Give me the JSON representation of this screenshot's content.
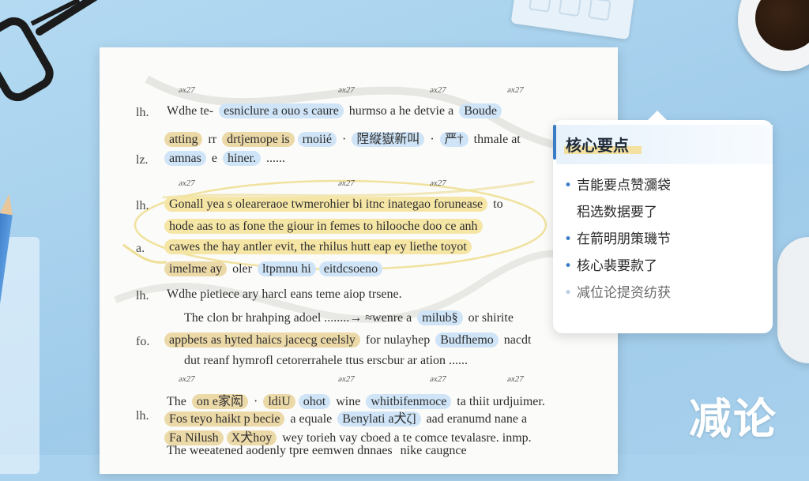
{
  "document": {
    "marks": [
      "əx27",
      "əx27",
      "əx27",
      "əx27",
      "əx27",
      "əx27",
      "əx27",
      "əx27",
      "əx27",
      "əx27",
      "əx27"
    ],
    "rows": [
      {
        "label": "lh.",
        "segments": [
          {
            "text": "Wdhe te-",
            "style": "plain"
          },
          {
            "text": "esniclure a ouo s caure",
            "style": "blue"
          },
          {
            "text": "hurmso a he detvie a",
            "style": "plain"
          },
          {
            "text": "Boude",
            "style": "blue"
          }
        ]
      },
      {
        "label": "",
        "segments": [
          {
            "text": "atting",
            "style": "tan"
          },
          {
            "text": "rr",
            "style": "plain"
          },
          {
            "text": "drtjemope is",
            "style": "tan"
          },
          {
            "text": "rnoiié",
            "style": "blue"
          },
          {
            "text": "·",
            "style": "plain"
          },
          {
            "text": "陧縦嶽新叫",
            "style": "blue"
          },
          {
            "text": "·",
            "style": "plain"
          },
          {
            "text": "严†",
            "style": "blue"
          },
          {
            "text": "thmale at",
            "style": "plain"
          }
        ]
      },
      {
        "label": "lz.",
        "segments": [
          {
            "text": "amnas",
            "style": "blue"
          },
          {
            "text": "e",
            "style": "plain"
          },
          {
            "text": "hiner.",
            "style": "blue"
          },
          {
            "text": "......",
            "style": "plain"
          }
        ]
      },
      {
        "label": "lh.",
        "segments": [
          {
            "text": "Gonall yea s oleareraoe twmerohier bi itnc inategao forunease",
            "style": "yellow"
          },
          {
            "text": "to",
            "style": "plain"
          }
        ]
      },
      {
        "label": "",
        "segments": [
          {
            "text": "hode aas to as fone the giour in femes to hilooche doo ce anh",
            "style": "yellow"
          }
        ]
      },
      {
        "label": "a.",
        "segments": [
          {
            "text": "cawes the hay antler evit, the rhilus hutt eap ey liethe toyot",
            "style": "yellow"
          }
        ]
      },
      {
        "label": "",
        "segments": [
          {
            "text": "imelme ay",
            "style": "tan"
          },
          {
            "text": "oler",
            "style": "plain"
          },
          {
            "text": "ltpmnu hi",
            "style": "blue"
          },
          {
            "text": "eitdcsoeno",
            "style": "blue"
          }
        ]
      },
      {
        "label": "lh.",
        "segments": [
          {
            "text": "Wdhe pietiece ary harcl eans teme aiop trsene.",
            "style": "plain"
          }
        ]
      },
      {
        "label": "",
        "segments": [
          {
            "text": "The clon br hrahping adoel ........→ ≈wenre a",
            "style": "plain"
          },
          {
            "text": "milub§",
            "style": "blue"
          },
          {
            "text": "or shirite",
            "style": "plain"
          }
        ]
      },
      {
        "label": "fo.",
        "segments": [
          {
            "text": "appbets as hyted haics jacecg ceelsly",
            "style": "tan"
          },
          {
            "text": "for nulayhep",
            "style": "plain"
          },
          {
            "text": "Budfhemo",
            "style": "blue"
          },
          {
            "text": "nacdt",
            "style": "plain"
          }
        ]
      },
      {
        "label": "",
        "segments": [
          {
            "text": "dut reanf hymrofl cetorerrahele ttus erscbur ar ation ......",
            "style": "plain"
          }
        ]
      },
      {
        "label": "",
        "segments": [
          {
            "text": "The",
            "style": "plain"
          },
          {
            "text": "on e家闳",
            "style": "tan"
          },
          {
            "text": "·",
            "style": "plain"
          },
          {
            "text": "ldiU",
            "style": "tan"
          },
          {
            "text": "ohot",
            "style": "blue"
          },
          {
            "text": "wine",
            "style": "plain"
          },
          {
            "text": "whitbifenmoce",
            "style": "blue"
          },
          {
            "text": "ta thiit urdjuimer.",
            "style": "plain"
          }
        ]
      },
      {
        "label": "lh.",
        "segments": [
          {
            "text": "Fos teyo haikt p becie",
            "style": "tan"
          },
          {
            "text": "a equale",
            "style": "plain"
          },
          {
            "text": "Benylati a犬ζ𣊞]",
            "style": "blue"
          },
          {
            "text": "aad eranumd nane a",
            "style": "plain"
          }
        ]
      },
      {
        "label": "",
        "segments": [
          {
            "text": "Fa Nilush",
            "style": "tan"
          },
          {
            "text": "X犬hoy",
            "style": "tan"
          },
          {
            "text": "wey torieh vay cboed a te comce tevalasre. inmp.",
            "style": "plain"
          }
        ]
      },
      {
        "label": "",
        "segments": [
          {
            "text": "The weeatened aodenly tpre eemwen dnnaes",
            "style": "plain"
          },
          {
            "text": "nike caugnce",
            "style": "plain"
          }
        ]
      }
    ]
  },
  "note": {
    "title": "核心要点",
    "items": [
      {
        "text": "吉能要点赞瀰袋",
        "bullet": true,
        "faded": false
      },
      {
        "text": "稆选数据要了",
        "bullet": false,
        "faded": false
      },
      {
        "text": "在箭明朋策璣节",
        "bullet": true,
        "faded": false
      },
      {
        "text": "核心裴要款了",
        "bullet": true,
        "faded": false
      },
      {
        "text": "减位论提资纺获",
        "bullet": true,
        "faded": true
      }
    ]
  },
  "brand": "减论",
  "colors": {
    "background": "#a9d2ee",
    "highlight_blue": "#cfe4f7",
    "highlight_yellow": "#f6e6a6",
    "highlight_tan": "#ecd9a8",
    "accent": "#3a7cc6"
  },
  "icons": [
    "eyeglasses-icon",
    "pencil-icon",
    "coffee-cup-icon",
    "mouse-icon"
  ]
}
